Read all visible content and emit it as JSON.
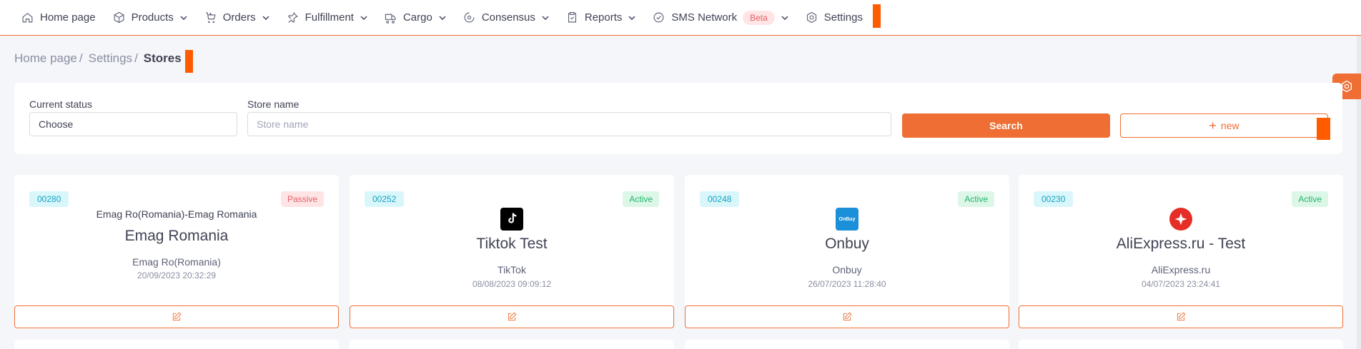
{
  "nav": {
    "items": [
      {
        "label": "Home page",
        "icon": "home-icon"
      },
      {
        "label": "Products",
        "icon": "box-icon"
      },
      {
        "label": "Orders",
        "icon": "orders-icon"
      },
      {
        "label": "Fulfillment",
        "icon": "pin-icon"
      },
      {
        "label": "Cargo",
        "icon": "truck-icon"
      },
      {
        "label": "Consensus",
        "icon": "consensus-icon"
      },
      {
        "label": "Reports",
        "icon": "clipboard-icon"
      },
      {
        "label": "SMS Network",
        "icon": "check-circle-icon",
        "badge": "Beta"
      },
      {
        "label": "Settings",
        "icon": "gear-icon"
      }
    ]
  },
  "breadcrumb": {
    "items": [
      "Home page",
      "Settings"
    ],
    "separator": "/",
    "current": "Stores"
  },
  "filter": {
    "status_label": "Current status",
    "status_value": "Choose",
    "store_label": "Store name",
    "store_placeholder": "Store name",
    "search_label": "Search",
    "new_label": "new"
  },
  "cards": [
    {
      "id": "00280",
      "status": "Passive",
      "image_alt": "Emag Ro(Romania)-Emag Romania",
      "title": "Emag Romania",
      "platform": "Emag Ro(Romania)",
      "date": "20/09/2023 20:32:29"
    },
    {
      "id": "00252",
      "status": "Active",
      "logo": "tiktok-logo",
      "logo_text": "TikTok",
      "title": "Tiktok Test",
      "platform": "TikTok",
      "date": "08/08/2023 09:09:12"
    },
    {
      "id": "00248",
      "status": "Active",
      "logo": "onbuy-logo",
      "logo_text": "OnBuy",
      "title": "Onbuy",
      "platform": "Onbuy",
      "date": "26/07/2023 11:28:40"
    },
    {
      "id": "00230",
      "status": "Active",
      "logo": "aliexpress-logo",
      "title": "AliExpress.ru - Test",
      "platform": "AliExpress.ru",
      "date": "04/07/2023 23:24:41"
    }
  ],
  "colors": {
    "accent": "#ee6e33",
    "active": "#22b569",
    "passive": "#e45d63",
    "id_badge": "#16a3c0"
  }
}
